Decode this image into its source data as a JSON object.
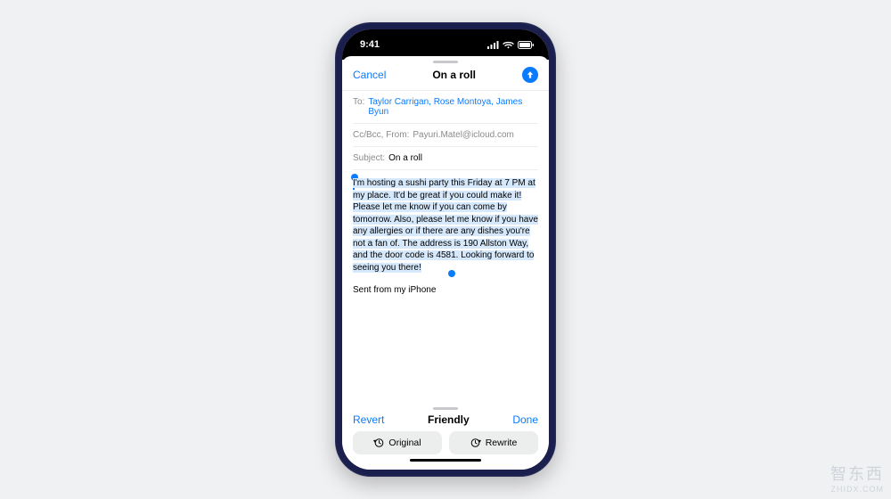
{
  "statusbar": {
    "time": "9:41"
  },
  "nav": {
    "cancel": "Cancel",
    "title": "On a roll"
  },
  "fields": {
    "to_label": "To:",
    "to_value": "Taylor Carrigan, Rose Montoya, James Byun",
    "ccbcc_label": "Cc/Bcc, From:",
    "from_value": "Payuri.Matel@icloud.com",
    "subject_label": "Subject:",
    "subject_value": "On a roll"
  },
  "body": {
    "selected_text": "I'm hosting a sushi party this Friday at 7 PM at my place. It'd be great if you could make it! Please let me know if you can come by tomorrow. Also, please let me know if you have any allergies or if there are any dishes you're not a fan of. The address is 190 Allston Way, and the door code is 4581. Looking forward to seeing you there!",
    "signature": "Sent from my iPhone"
  },
  "toolbar": {
    "revert": "Revert",
    "mode": "Friendly",
    "done": "Done",
    "original": "Original",
    "rewrite": "Rewrite"
  },
  "watermark": {
    "line1": "智东西",
    "line2": "ZHIDX.COM"
  }
}
